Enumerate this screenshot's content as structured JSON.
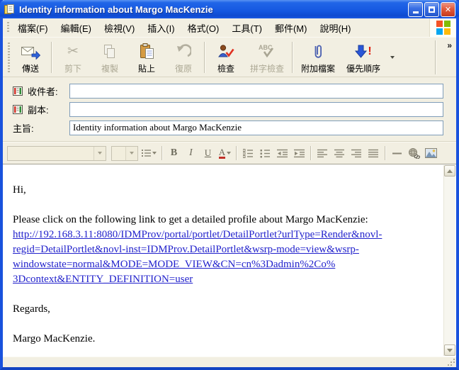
{
  "window": {
    "title": "Identity information about Margo MacKenzie"
  },
  "menu": {
    "items": [
      "檔案(F)",
      "編輯(E)",
      "檢視(V)",
      "插入(I)",
      "格式(O)",
      "工具(T)",
      "郵件(M)",
      "說明(H)"
    ]
  },
  "toolbar": {
    "buttons": [
      {
        "label": "傳送",
        "name": "send",
        "enabled": true
      },
      {
        "label": "剪下",
        "name": "cut",
        "enabled": false
      },
      {
        "label": "複製",
        "name": "copy",
        "enabled": false
      },
      {
        "label": "貼上",
        "name": "paste",
        "enabled": true
      },
      {
        "label": "復原",
        "name": "undo",
        "enabled": false
      },
      {
        "label": "檢查",
        "name": "check-names",
        "enabled": true
      },
      {
        "label": "拼字檢查",
        "name": "spelling",
        "enabled": false
      },
      {
        "label": "附加檔案",
        "name": "attach-file",
        "enabled": true
      },
      {
        "label": "優先順序",
        "name": "priority",
        "enabled": true
      }
    ],
    "overflow_chevron": "»",
    "priority_exclamation": "!"
  },
  "fields": {
    "to_label": "收件者:",
    "cc_label": "副本:",
    "subject_label": "主旨:",
    "to_value": "",
    "cc_value": "",
    "subject_value": "Identity information about Margo MacKenzie"
  },
  "format_toolbar": {
    "font_name_value": "",
    "font_size_value": "",
    "bold": "B",
    "italic": "I",
    "underline": "U",
    "font_color": "A"
  },
  "body": {
    "greeting": "Hi,",
    "intro": "Please click on the following link to get a detailed profile about Margo MacKenzie:",
    "link_lines": [
      "http://192.168.3.11:8080/IDMProv/portal/portlet/DetailPortlet?urlType=Render&novl-",
      "regid=DetailPortlet&novl-inst=IDMProv.DetailPortlet&wsrp-mode=view&wsrp-",
      "windowstate=normal&MODE=MODE_VIEW&CN=cn%3Dadmin%2Co%",
      "3Dcontext&ENTITY_DEFINITION=user"
    ],
    "link_url": "http://192.168.3.11:8080/IDMProv/portal/portlet/DetailPortlet?urlType=Render&novl-regid=DetailPortlet&novl-inst=IDMProv.DetailPortlet&wsrp-mode=view&wsrp-windowstate=normal&MODE=MODE_VIEW&CN=cn%3Dadmin%2Co%3Dcontext&ENTITY_DEFINITION=user",
    "regards": "Regards,",
    "signature": "Margo MacKenzie."
  },
  "colors": {
    "titlebar_blue": "#1557e0",
    "window_border": "#1952dd",
    "chrome_beige": "#f2efe2",
    "link_blue": "#2222cc",
    "close_red": "#e25b3c",
    "input_border": "#7f9db9"
  }
}
